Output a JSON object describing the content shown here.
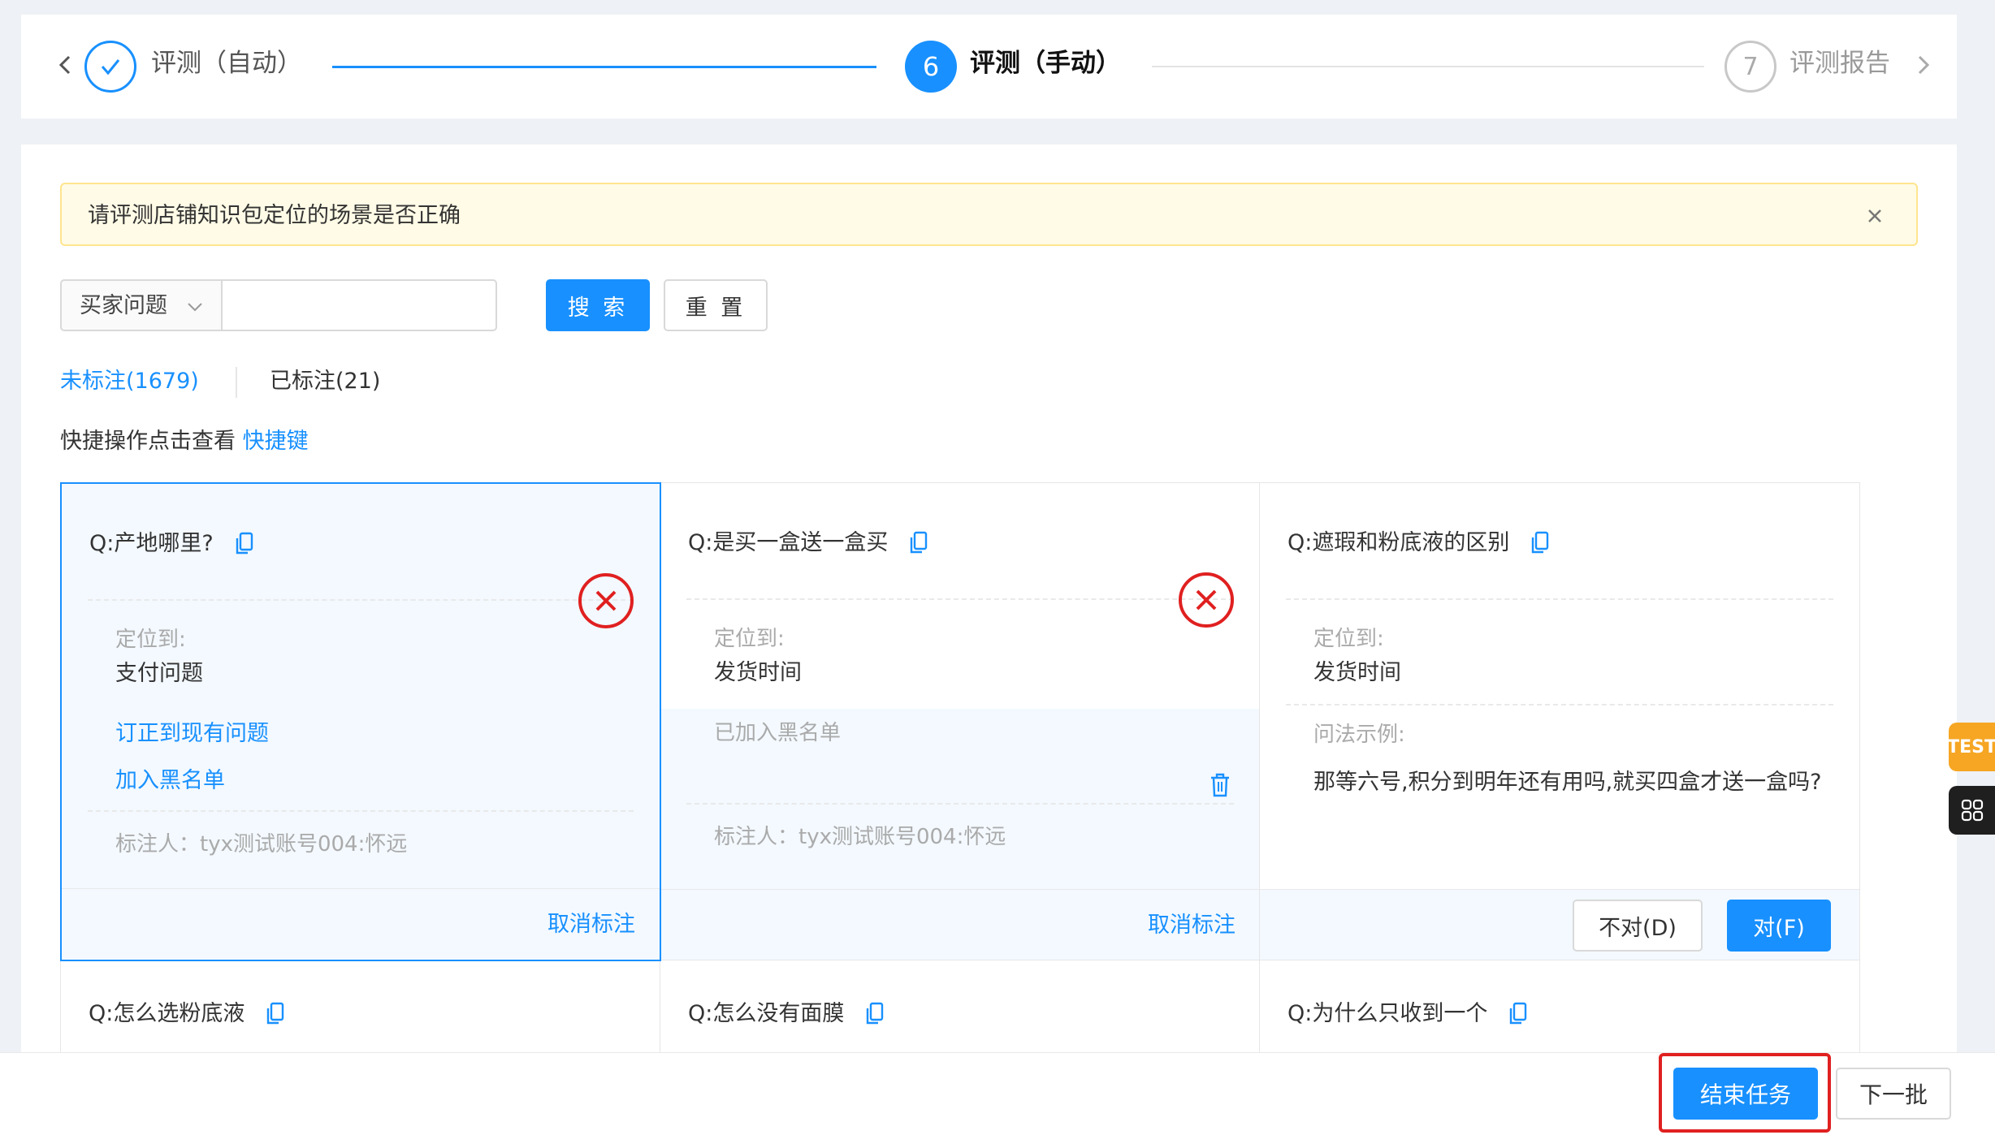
{
  "steps": {
    "done_label": "评测（自动）",
    "active_number": "6",
    "active_label": "评测（手动）",
    "pending_number": "7",
    "pending_label": "评测报告"
  },
  "notice": {
    "text": "请评测店铺知识包定位的场景是否正确"
  },
  "search": {
    "select_value": "买家问题",
    "input_value": "",
    "search_button": "搜 索",
    "reset_button": "重 置"
  },
  "tabs": {
    "unmarked": "未标注(1679)",
    "marked": "已标注(21)"
  },
  "hint": {
    "text": "快捷操作点击查看",
    "link": "快捷键"
  },
  "cards": [
    {
      "question": "Q:产地哪里?",
      "located_label": "定位到:",
      "located_value": "支付问题",
      "correct_link": "订正到现有问题",
      "blacklist_link": "加入黑名单",
      "marker": "标注人：tyx测试账号004:怀远",
      "cancel": "取消标注"
    },
    {
      "question": "Q:是买一盒送一盒买",
      "located_label": "定位到:",
      "located_value": "发货时间",
      "blacklisted": "已加入黑名单",
      "marker": "标注人：tyx测试账号004:怀远",
      "cancel": "取消标注"
    },
    {
      "question": "Q:遮瑕和粉底液的区别",
      "located_label": "定位到:",
      "located_value": "发货时间",
      "example_label": "问法示例:",
      "example_text": "那等六号,积分到明年还有用吗,就买四盒才送一盒吗?",
      "wrong_button": "不对(D)",
      "right_button": "对(F)"
    },
    {
      "question": "Q:怎么选粉底液"
    },
    {
      "question": "Q:怎么没有面膜"
    },
    {
      "question": "Q:为什么只收到一个"
    }
  ],
  "footer": {
    "end_task": "结束任务",
    "next_batch": "下一批"
  },
  "side": {
    "test_badge": "TEST"
  },
  "colors": {
    "primary": "#1890ff",
    "danger": "#e02020",
    "warning_bg": "#fffbe6",
    "test_badge": "#f6a623"
  },
  "icons": [
    "back-icon",
    "check-icon",
    "forward-icon",
    "close-icon",
    "chevron-down-icon",
    "copy-icon",
    "wrong-circle-icon",
    "trash-icon",
    "grid-icon"
  ]
}
